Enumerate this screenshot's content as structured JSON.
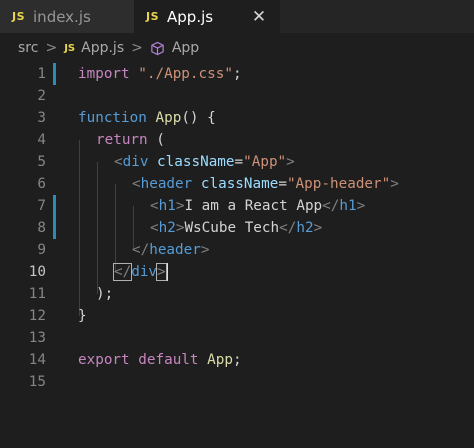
{
  "tabs": [
    {
      "badge": "JS",
      "label": "index.js",
      "active": false
    },
    {
      "badge": "JS",
      "label": "App.js",
      "active": true,
      "close": "✕"
    }
  ],
  "breadcrumb": {
    "folder": "src",
    "file_badge": "JS",
    "file": "App.js",
    "symbol": "App",
    "separator": ">"
  },
  "editor": {
    "line_numbers": [
      "1",
      "2",
      "3",
      "4",
      "5",
      "6",
      "7",
      "8",
      "9",
      "10",
      "11",
      "12",
      "13",
      "14",
      "15"
    ],
    "current_line": "10",
    "lines": [
      [
        "import",
        " ",
        "\"./App.css\"",
        ";"
      ],
      [],
      [
        "function",
        " ",
        "App",
        "() {"
      ],
      [
        "return",
        " ("
      ],
      [
        "<",
        "div",
        " ",
        "className",
        "=",
        "\"App\"",
        ">"
      ],
      [
        "<",
        "header",
        " ",
        "className",
        "=",
        "\"App-header\"",
        ">"
      ],
      [
        "<",
        "h1",
        ">",
        "I am a React App",
        "</",
        "h1",
        ">"
      ],
      [
        "<",
        "h2",
        ">",
        "WsCube Tech",
        "</",
        "h2",
        ">"
      ],
      [
        "</",
        "header",
        ">"
      ],
      [
        "</",
        "div",
        ">"
      ],
      [
        ");"
      ],
      [
        "}"
      ],
      [],
      [
        "export",
        " ",
        "default",
        " ",
        "App",
        ";"
      ],
      []
    ]
  },
  "colors": {
    "background": "#1e1e1e",
    "gutter_modified": "#2a8cb5",
    "keyword": "#569cd6",
    "control": "#c586c0",
    "function": "#dcdcaa",
    "string": "#ce9178",
    "attribute": "#9cdcfe",
    "js_badge": "#e8d44d"
  }
}
